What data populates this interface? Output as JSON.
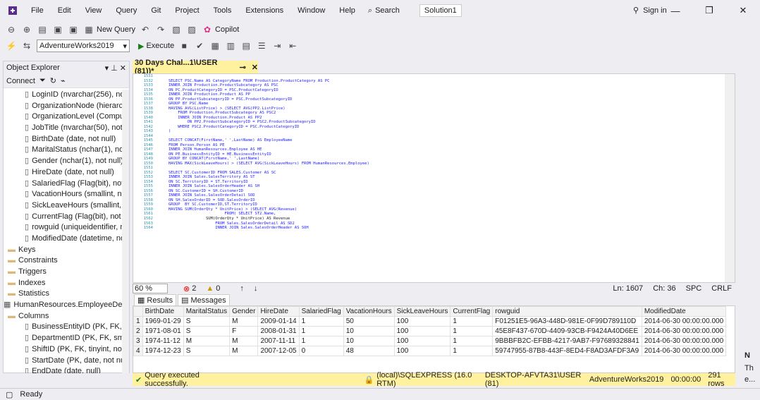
{
  "menu": {
    "items": [
      "File",
      "Edit",
      "View",
      "Query",
      "Git",
      "Project",
      "Tools",
      "Extensions",
      "Window",
      "Help"
    ],
    "search_label": "Search",
    "solution_label": "Solution1",
    "signin_label": "Sign in"
  },
  "toolbar": {
    "new_query_label": "New Query",
    "copilot_label": "Copilot",
    "database_value": "AdventureWorks2019",
    "execute_label": "Execute"
  },
  "object_explorer": {
    "title": "Object Explorer",
    "connect_label": "Connect",
    "tree": [
      "LoginID (nvarchar(256), not n",
      "OrganizationNode (hierarchyi",
      "OrganizationLevel (Computec",
      "JobTitle (nvarchar(50), not nul",
      "BirthDate (date, not null)",
      "MaritalStatus (nchar(1), not nu",
      "Gender (nchar(1), not null)",
      "HireDate (date, not null)",
      "SalariedFlag (Flag(bit), not nu",
      "VacationHours (smallint, not r",
      "SickLeaveHours (smallint, not",
      "CurrentFlag (Flag(bit), not nul",
      "rowguid (uniqueidentifier, not",
      "ModifiedDate (datetime, not",
      "Keys",
      "Constraints",
      "Triggers",
      "Indexes",
      "Statistics",
      "HumanResources.EmployeeDepar",
      "Columns",
      "BusinessEntityID (PK, FK, int, r",
      "DepartmentID (PK, FK, smallir",
      "ShiftID (PK, FK, tinyint, not nu",
      "StartDate (PK, date, not null)",
      "EndDate (date, null)"
    ]
  },
  "editor": {
    "tab_title": "30 Days Chal...1\\USER (81))*",
    "zoom": "60 %",
    "errors": "2",
    "warnings": "0",
    "line": "Ln: 1607",
    "col": "Ch: 36",
    "mode1": "SPC",
    "mode2": "CRLF",
    "line_numbers": [
      "1531",
      "1532",
      "1533",
      "1534",
      "1535",
      "1536",
      "1537",
      "1538",
      "1539",
      "1540",
      "1541",
      "1542",
      "1543",
      "1544",
      "1545",
      "1546",
      "1547",
      "1548",
      "1549",
      "1550",
      "1551",
      "1552",
      "1553",
      "1554",
      "1555",
      "1556",
      "1557",
      "1558",
      "1559",
      "1560",
      "1561",
      "1562",
      "1563",
      "1564"
    ],
    "code_lines": [
      "",
      "SELECT PSC.Name AS CategoryName FROM Production.ProductCategory AS PC",
      "INNER JOIN Production.ProductSubcategory AS PSC",
      "ON PC.ProductCategoryID = PSC.ProductCategoryID",
      "INNER JOIN Production.Product AS PP",
      "ON PP.ProductSubcategoryID = PSC.ProductSubcategoryID",
      "GROUP BY PSC.Name",
      "HAVING AVG(ListPrice) > (SELECT AVG(PP2.ListPrice)",
      "    FROM Production.ProductSubcategory AS PSC2",
      "    INNER JOIN Production.Product AS PP2",
      "        ON PP2.ProductSubcategoryID = PSC2.ProductSubcategoryID",
      "    WHERE PSC2.ProductCategoryID = PSC.ProductCategoryID",
      ")",
      "",
      "SELECT CONCAT(FirstName,' ',LastName) AS EmployeeName",
      "FROM Person.Person AS PE",
      "INNER JOIN HumanResources.Employee AS HE",
      "ON PE.BusinessEntityID = HE.BusinessEntityID",
      "GROUP BY CONCAT(FirstName,' ',LastName)",
      "HAVING MAX(SickLeaveHours) > (SELECT AVG(SickLeaveHours) FROM HumanResources.Employee)",
      "",
      "SELECT SC.CustomerID FROM SALES.Customer AS SC",
      "INNER JOIN Sales.SalesTerritory AS ST",
      "ON SC.TerritoryID = ST.TerritoryID",
      "INNER JOIN Sales.SalesOrderHeader AS SH",
      "ON SC.CustomerID = SH.CustomerID",
      "INNER JOIN Sales.SalesOrderDetail SOD",
      "ON SH.SalesOrderID = SOD.SalesOrderID",
      "GROUP  BY SC.CustomerID,ST.TerritoryID",
      "HAVING SUM(OrderQty * UnitPrice) > (SELECT AVG(Revenue)",
      "                        FROM( SELECT ST2.Name,",
      "                SUM(OrderQty * UnitPrice) AS Revenue",
      "                    FROM Sales.SalesOrderDetail AS SD2",
      "                    INNER JOIN Sales.SalesOrderHeader AS SOH"
    ]
  },
  "results": {
    "tab_results": "Results",
    "tab_messages": "Messages",
    "columns": [
      "",
      "BirthDate",
      "MaritalStatus",
      "Gender",
      "HireDate",
      "SalariedFlag",
      "VacationHours",
      "SickLeaveHours",
      "CurrentFlag",
      "rowguid",
      "ModifiedDate"
    ],
    "rows": [
      [
        "1",
        "1969-01-29",
        "S",
        "M",
        "2009-01-14",
        "1",
        "50",
        "100",
        "1",
        "F01251E5-96A3-448D-981E-0F99D789110D",
        "2014-06-30 00:00:00.000"
      ],
      [
        "2",
        "1971-08-01",
        "S",
        "F",
        "2008-01-31",
        "1",
        "10",
        "100",
        "1",
        "45E8F437-670D-4409-93CB-F9424A40D6EE",
        "2014-06-30 00:00:00.000"
      ],
      [
        "3",
        "1974-11-12",
        "M",
        "M",
        "2007-11-11",
        "1",
        "10",
        "100",
        "1",
        "9BBBFB2C-EFBB-4217-9AB7-F97689328841",
        "2014-06-30 00:00:00.000"
      ],
      [
        "4",
        "1974-12-23",
        "S",
        "M",
        "2007-12-05",
        "0",
        "48",
        "100",
        "1",
        "59747955-87B8-443F-8ED4-F8AD3AFDF3A9",
        "2014-06-30 00:00:00.000"
      ]
    ]
  },
  "exec_status": {
    "message": "Query executed successfully.",
    "server": "(local)\\SQLEXPRESS (16.0 RTM)",
    "user": "DESKTOP-AFVTA31\\USER (81)",
    "database": "AdventureWorks2019",
    "elapsed": "00:00:00",
    "rows": "291 rows"
  },
  "status_bar": {
    "ready": "Ready"
  },
  "right_panel": {
    "letter": "N",
    "text1": "Th",
    "text2": "e..."
  },
  "colors": {
    "accent_yellow": "#fff19d",
    "keyword": "#1a1aff",
    "chrome": "#eeeef2"
  }
}
